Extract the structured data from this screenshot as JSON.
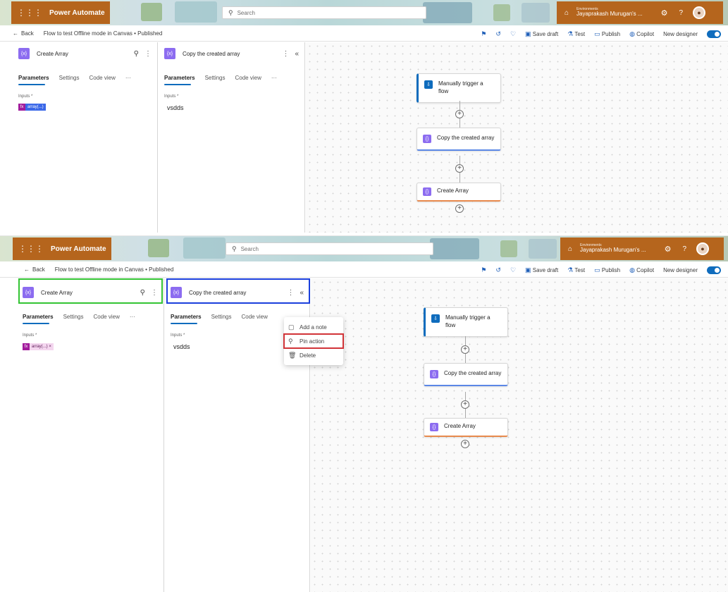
{
  "app": {
    "name": "Power Automate",
    "search_placeholder": "Search",
    "environment_label": "Environments",
    "environment_name": "Jayaprakash Murugan's ..."
  },
  "commandbar": {
    "back": "Back",
    "breadcrumb": "Flow to test Offline mode in Canvas • Published",
    "save_draft": "Save draft",
    "test": "Test",
    "publish": "Publish",
    "copilot": "Copilot",
    "new_designer": "New designer"
  },
  "panels": {
    "create": {
      "title": "Create Array",
      "tabs": [
        "Parameters",
        "Settings",
        "Code view",
        "···"
      ],
      "inputs_label": "Inputs *",
      "token_top": "array(...)",
      "token_bottom": "array(...) ×"
    },
    "copy": {
      "title": "Copy the created array",
      "tabs": [
        "Parameters",
        "Settings",
        "Code view",
        "···"
      ],
      "inputs_label": "Inputs *",
      "value": "vsdds"
    }
  },
  "flow": {
    "nodes": [
      "Manually trigger a flow",
      "Copy the created array",
      "Create Array"
    ]
  },
  "context_menu": {
    "items": [
      "Add a note",
      "Pin action",
      "Delete"
    ]
  },
  "colors": {
    "brand": "#b5651d",
    "accent": "#0f6cbd",
    "action_icon": "#8c6cf0",
    "highlight_green": "#33c433",
    "highlight_blue": "#1b3fdc",
    "highlight_red": "#d13438"
  }
}
